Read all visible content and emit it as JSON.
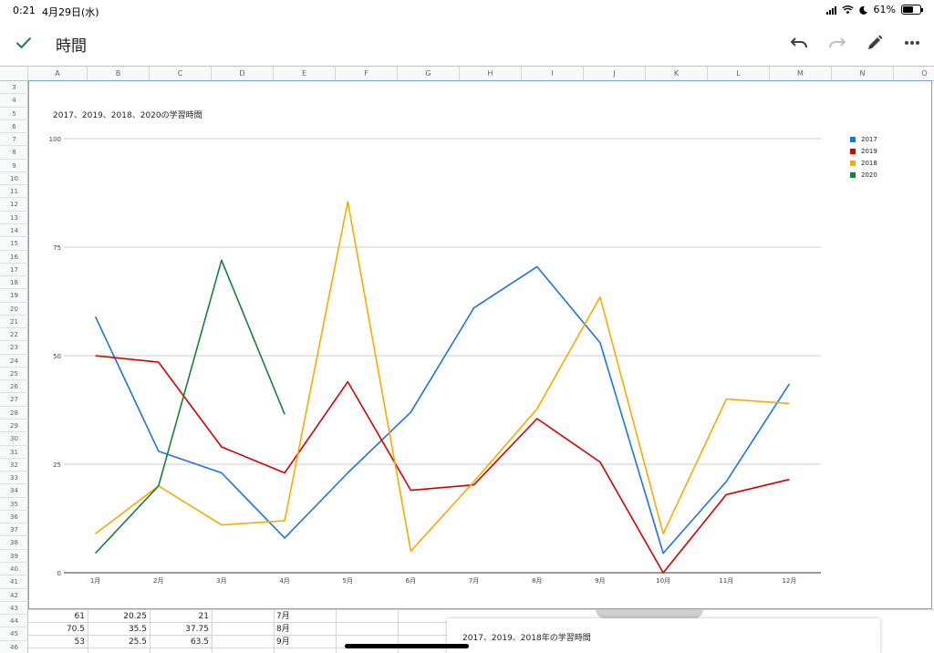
{
  "status_bar": {
    "time": "0:21",
    "date": "4月29日(水)",
    "battery_percent": "61%",
    "battery_level": 0.61
  },
  "toolbar": {
    "title": "時間"
  },
  "columns": [
    "A",
    "B",
    "C",
    "D",
    "E",
    "F",
    "G",
    "H",
    "I",
    "J",
    "K",
    "L",
    "M",
    "N",
    "O"
  ],
  "rows": [
    "3",
    "4",
    "5",
    "6",
    "7",
    "8",
    "9",
    "10",
    "11",
    "12",
    "13",
    "14",
    "15",
    "16",
    "17",
    "18",
    "19",
    "20",
    "21",
    "22",
    "23",
    "24",
    "25",
    "26",
    "27",
    "28",
    "29",
    "30",
    "31",
    "32",
    "33",
    "34",
    "35",
    "36",
    "37",
    "38",
    "39",
    "40",
    "41",
    "42",
    "43",
    "44",
    "45",
    "46",
    "47"
  ],
  "grid": [
    {
      "a": "61",
      "b": "20.25",
      "c": "21",
      "e": "7月"
    },
    {
      "a": "70.5",
      "b": "35.5",
      "c": "37.75",
      "e": "8月"
    },
    {
      "a": "53",
      "b": "25.5",
      "c": "63.5",
      "e": "9月"
    }
  ],
  "chart_data": {
    "type": "line",
    "title": "2017、2019、2018、2020の学習時間",
    "categories": [
      "1月",
      "2月",
      "3月",
      "4月",
      "5月",
      "6月",
      "7月",
      "8月",
      "9月",
      "10月",
      "11月",
      "12月"
    ],
    "ylim": [
      0,
      100
    ],
    "yticks": [
      0,
      25,
      50,
      75,
      100
    ],
    "grid": true,
    "legend": "right",
    "series": [
      {
        "name": "2017",
        "color": "#1a73e8",
        "values": [
          59,
          28,
          23,
          8,
          23,
          37,
          61,
          70.5,
          53,
          4.5,
          21,
          43.5
        ]
      },
      {
        "name": "2019",
        "color": "#d50000",
        "values": [
          50,
          48.5,
          29,
          23,
          44,
          19,
          20.25,
          35.5,
          25.5,
          0,
          18,
          21.5
        ]
      },
      {
        "name": "2018",
        "color": "#f9ab00",
        "values": [
          9,
          20,
          11,
          12,
          85.5,
          5,
          21,
          37.75,
          63.5,
          9,
          40,
          39
        ]
      },
      {
        "name": "2020",
        "color": "#188038",
        "values": [
          4.5,
          20,
          72,
          36.5,
          null,
          null,
          null,
          null,
          null,
          null,
          null,
          null
        ]
      }
    ]
  },
  "chart2": {
    "title": "2017、2019、2018年の学習時間"
  }
}
